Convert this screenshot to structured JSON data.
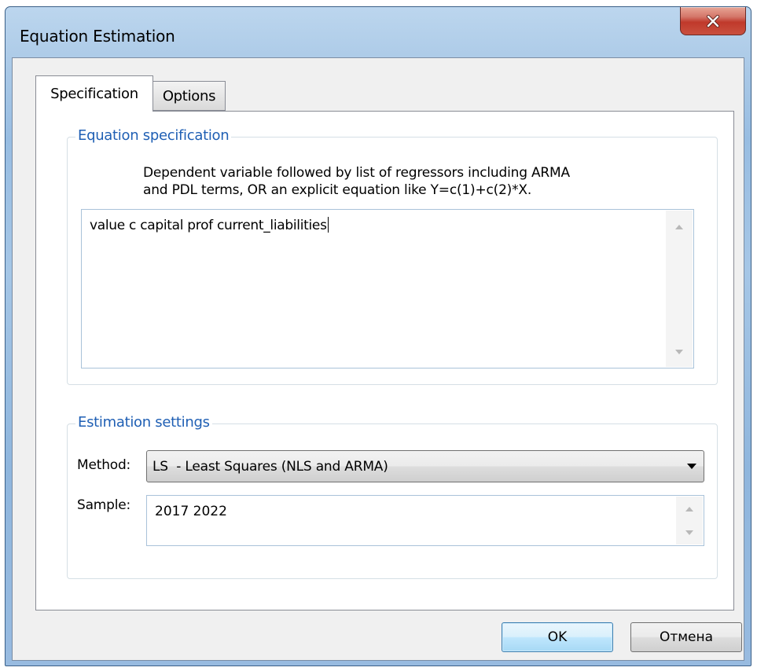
{
  "window": {
    "title": "Equation Estimation"
  },
  "tabs": [
    {
      "label": "Specification",
      "selected": true
    },
    {
      "label": "Options",
      "selected": false
    }
  ],
  "equation_spec": {
    "group_title": "Equation specification",
    "description_line1": "Dependent variable followed by list of regressors including ARMA",
    "description_line2": "and PDL terms, OR an explicit equation like Y=c(1)+c(2)*X.",
    "value": "value c capital prof current_liabilities"
  },
  "estimation_settings": {
    "group_title": "Estimation settings",
    "method_label": "Method:",
    "method_value": "LS  - Least Squares (NLS and ARMA)",
    "sample_label": "Sample:",
    "sample_value": "2017 2022"
  },
  "buttons": {
    "ok": "OK",
    "cancel": "Отмена"
  },
  "colors": {
    "group_title": "#1f5fb4",
    "close_button": "#c0392b",
    "title_bar": "#a5c6e6"
  },
  "icons": {
    "close": "close-icon",
    "dropdown": "chevron-down-icon",
    "scroll_up": "scroll-up-icon",
    "scroll_down": "scroll-down-icon"
  }
}
